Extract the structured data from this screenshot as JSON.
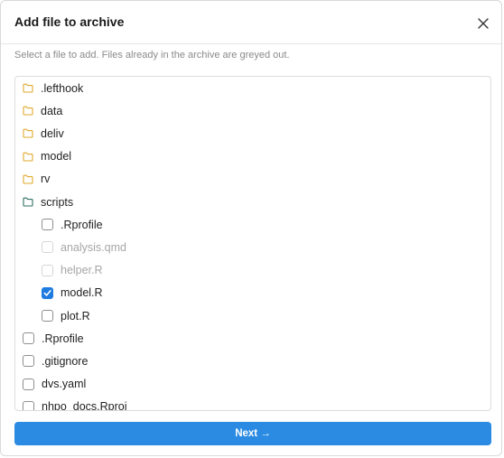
{
  "dialog": {
    "title": "Add file to archive",
    "hint": "Select a file to add. Files already in the archive are greyed out.",
    "next_label": "Next →"
  },
  "colors": {
    "folder": "#e0a92c",
    "folder_open": "#2f6f62",
    "checkbox_checked": "#1e7be0",
    "primary_button": "#2b8be2"
  },
  "tree": [
    {
      "type": "folder",
      "name": ".lefthook",
      "icon": "folder-icon"
    },
    {
      "type": "folder",
      "name": "data",
      "icon": "folder-icon"
    },
    {
      "type": "folder",
      "name": "deliv",
      "icon": "folder-icon"
    },
    {
      "type": "folder",
      "name": "model",
      "icon": "folder-icon"
    },
    {
      "type": "folder",
      "name": "rv",
      "icon": "folder-icon"
    },
    {
      "type": "folder",
      "name": "scripts",
      "icon": "folder-open-icon",
      "expanded": true
    },
    {
      "type": "file",
      "name": ".Rprofile",
      "checked": false,
      "disabled": false,
      "level": 1
    },
    {
      "type": "file",
      "name": "analysis.qmd",
      "checked": false,
      "disabled": true,
      "level": 1
    },
    {
      "type": "file",
      "name": "helper.R",
      "checked": false,
      "disabled": true,
      "level": 1
    },
    {
      "type": "file",
      "name": "model.R",
      "checked": true,
      "disabled": false,
      "level": 1
    },
    {
      "type": "file",
      "name": "plot.R",
      "checked": false,
      "disabled": false,
      "level": 1
    },
    {
      "type": "file",
      "name": ".Rprofile",
      "checked": false,
      "disabled": false,
      "level": 0
    },
    {
      "type": "file",
      "name": ".gitignore",
      "checked": false,
      "disabled": false,
      "level": 0
    },
    {
      "type": "file",
      "name": "dvs.yaml",
      "checked": false,
      "disabled": false,
      "level": 0
    },
    {
      "type": "file",
      "name": "nhpo_docs.Rproj",
      "checked": false,
      "disabled": false,
      "level": 0
    }
  ]
}
